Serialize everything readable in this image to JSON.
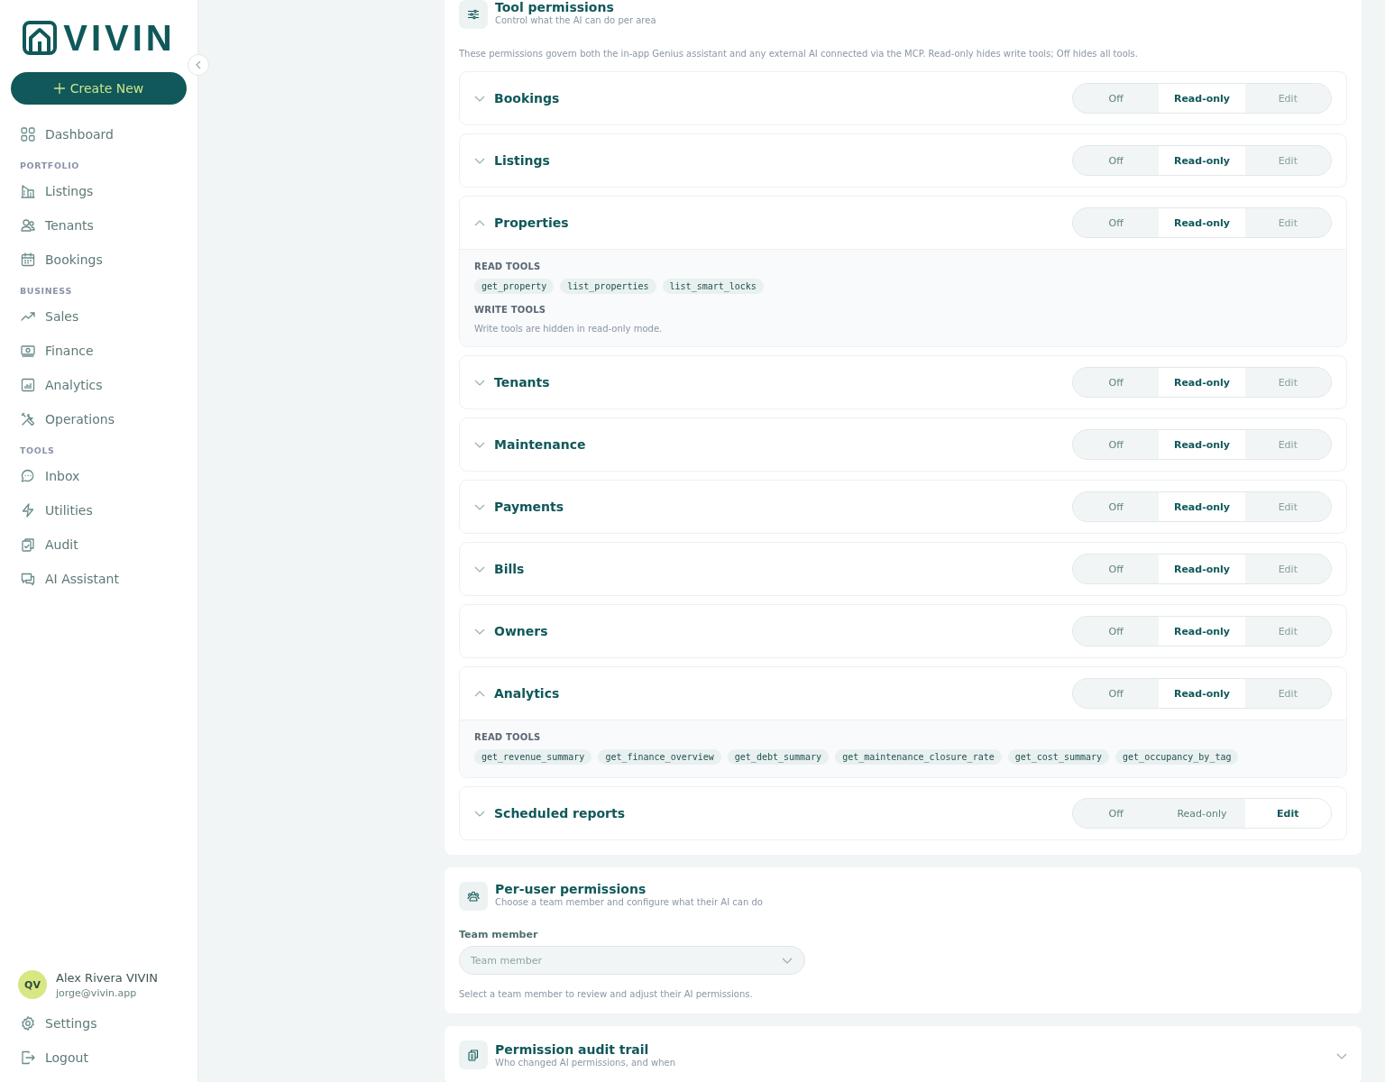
{
  "sidebar": {
    "brand": "VIVIN",
    "create_button": "Create New",
    "items": [
      {
        "kind": "item",
        "label": "Dashboard"
      },
      {
        "kind": "section",
        "label": "PORTFOLIO"
      },
      {
        "kind": "item",
        "label": "Listings"
      },
      {
        "kind": "item",
        "label": "Tenants"
      },
      {
        "kind": "item",
        "label": "Bookings"
      },
      {
        "kind": "section",
        "label": "BUSINESS"
      },
      {
        "kind": "item",
        "label": "Sales"
      },
      {
        "kind": "item",
        "label": "Finance"
      },
      {
        "kind": "item",
        "label": "Analytics"
      },
      {
        "kind": "item",
        "label": "Operations"
      },
      {
        "kind": "section",
        "label": "TOOLS"
      },
      {
        "kind": "item",
        "label": "Inbox"
      },
      {
        "kind": "item",
        "label": "Utilities"
      },
      {
        "kind": "item",
        "label": "Audit"
      },
      {
        "kind": "item",
        "label": "AI Assistant"
      }
    ],
    "user": {
      "initials": "QV",
      "name": "Alex Rivera VIVIN",
      "email": "jorge@vivin.app"
    },
    "footer_items": [
      {
        "label": "Settings"
      },
      {
        "label": "Logout"
      }
    ]
  },
  "tool_permissions": {
    "title": "Tool permissions",
    "subtitle": "Control what the AI can do per area",
    "description": "These permissions govern both the in-app Genius assistant and any external AI connected via the MCP. Read-only hides write tools; Off hides all tools.",
    "areas": [
      {
        "name": "Bookings",
        "expanded": false,
        "options": [
          {
            "label": "Off",
            "selected": false
          },
          {
            "label": "Read-only",
            "selected": true
          },
          {
            "label": "Edit",
            "selected": false
          }
        ]
      },
      {
        "name": "Listings",
        "expanded": false,
        "options": [
          {
            "label": "Off",
            "selected": false
          },
          {
            "label": "Read-only",
            "selected": true
          },
          {
            "label": "Edit",
            "selected": false
          }
        ]
      },
      {
        "name": "Properties",
        "expanded": true,
        "options": [
          {
            "label": "Off",
            "selected": false
          },
          {
            "label": "Read-only",
            "selected": true
          },
          {
            "label": "Edit",
            "selected": false
          }
        ],
        "read_tools_label": "READ TOOLS",
        "read_tools": [
          "get_property",
          "list_properties",
          "list_smart_locks"
        ],
        "write_tools_label": "WRITE TOOLS",
        "write_tools_note": "Write tools are hidden in read-only mode."
      },
      {
        "name": "Tenants",
        "expanded": false,
        "options": [
          {
            "label": "Off",
            "selected": false
          },
          {
            "label": "Read-only",
            "selected": true
          },
          {
            "label": "Edit",
            "selected": false
          }
        ]
      },
      {
        "name": "Maintenance",
        "expanded": false,
        "options": [
          {
            "label": "Off",
            "selected": false
          },
          {
            "label": "Read-only",
            "selected": true
          },
          {
            "label": "Edit",
            "selected": false
          }
        ]
      },
      {
        "name": "Payments",
        "expanded": false,
        "options": [
          {
            "label": "Off",
            "selected": false
          },
          {
            "label": "Read-only",
            "selected": true
          },
          {
            "label": "Edit",
            "selected": false
          }
        ]
      },
      {
        "name": "Bills",
        "expanded": false,
        "options": [
          {
            "label": "Off",
            "selected": false
          },
          {
            "label": "Read-only",
            "selected": true
          },
          {
            "label": "Edit",
            "selected": false
          }
        ]
      },
      {
        "name": "Owners",
        "expanded": false,
        "options": [
          {
            "label": "Off",
            "selected": false
          },
          {
            "label": "Read-only",
            "selected": true
          },
          {
            "label": "Edit",
            "selected": false
          }
        ]
      },
      {
        "name": "Analytics",
        "expanded": true,
        "options": [
          {
            "label": "Off",
            "selected": false
          },
          {
            "label": "Read-only",
            "selected": true
          },
          {
            "label": "Edit",
            "selected": false
          }
        ],
        "read_tools_label": "READ TOOLS",
        "read_tools": [
          "get_revenue_summary",
          "get_finance_overview",
          "get_debt_summary",
          "get_maintenance_closure_rate",
          "get_cost_summary",
          "get_occupancy_by_tag"
        ]
      },
      {
        "name": "Scheduled reports",
        "expanded": false,
        "options": [
          {
            "label": "Off",
            "selected": false
          },
          {
            "label": "Read-only",
            "selected": false
          },
          {
            "label": "Edit",
            "selected": true
          }
        ]
      }
    ]
  },
  "per_user": {
    "title": "Per-user permissions",
    "subtitle": "Choose a team member and configure what their AI can do",
    "field_label": "Team member",
    "placeholder": "Team member",
    "hint": "Select a team member to review and adjust their AI permissions."
  },
  "audit_trail": {
    "title": "Permission audit trail",
    "subtitle": "Who changed AI permissions, and when",
    "expanded": false
  }
}
